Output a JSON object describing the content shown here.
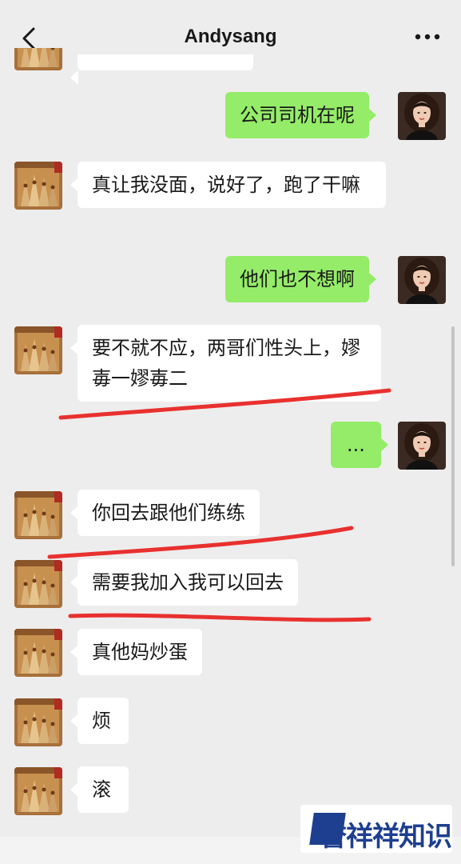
{
  "header": {
    "title": "Andysang"
  },
  "messages": [
    {
      "side": "out",
      "text": "公司司机在呢"
    },
    {
      "side": "in",
      "text": "真让我没面，说好了，跑了干嘛"
    },
    {
      "side": "out",
      "text": "他们也不想啊"
    },
    {
      "side": "in",
      "text": "要不就不应，两哥们性头上，嫪毐一嫪毐二"
    },
    {
      "side": "out",
      "text": "..."
    },
    {
      "side": "in",
      "text": "你回去跟他们练练"
    },
    {
      "side": "in",
      "text": "需要我加入我可以回去"
    },
    {
      "side": "in",
      "text": "真他妈炒蛋"
    },
    {
      "side": "in",
      "text": "烦"
    },
    {
      "side": "in",
      "text": "滚"
    }
  ],
  "watermark": {
    "text": "誉祥祥知识"
  },
  "colors": {
    "outgoing_bubble": "#95ec69",
    "incoming_bubble": "#ffffff",
    "annotation_line": "#e8312f",
    "watermark": "#1e3f8f"
  }
}
